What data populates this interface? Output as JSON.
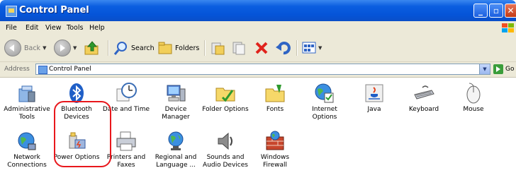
{
  "window": {
    "title": "Control Panel",
    "minimize": "_",
    "maximize": "▫",
    "close": "✕"
  },
  "menu": [
    "File",
    "Edit",
    "View",
    "Tools",
    "Help"
  ],
  "toolbar": {
    "back": "Back",
    "search": "Search",
    "folders": "Folders"
  },
  "address": {
    "label": "Address",
    "value": "Control Panel",
    "go": "Go"
  },
  "items": [
    {
      "l1": "Administrative",
      "l2": "Tools",
      "icon": "administrative-tools-icon"
    },
    {
      "l1": "Bluetooth",
      "l2": "Devices",
      "icon": "bluetooth-icon"
    },
    {
      "l1": "Date and Time",
      "l2": "",
      "icon": "date-time-icon"
    },
    {
      "l1": "Device",
      "l2": "Manager",
      "icon": "device-manager-icon"
    },
    {
      "l1": "Folder Options",
      "l2": "",
      "icon": "folder-options-icon"
    },
    {
      "l1": "Fonts",
      "l2": "",
      "icon": "fonts-icon"
    },
    {
      "l1": "Internet",
      "l2": "Options",
      "icon": "internet-options-icon"
    },
    {
      "l1": "Java",
      "l2": "",
      "icon": "java-icon"
    },
    {
      "l1": "Keyboard",
      "l2": "",
      "icon": "keyboard-icon"
    },
    {
      "l1": "Mouse",
      "l2": "",
      "icon": "mouse-icon"
    },
    {
      "l1": "Network",
      "l2": "Connections",
      "icon": "network-connections-icon"
    },
    {
      "l1": "Power Options",
      "l2": "",
      "icon": "power-options-icon"
    },
    {
      "l1": "Printers and",
      "l2": "Faxes",
      "icon": "printers-faxes-icon"
    },
    {
      "l1": "Regional and",
      "l2": "Language ...",
      "icon": "regional-language-icon"
    },
    {
      "l1": "Sounds and",
      "l2": "Audio Devices",
      "icon": "sounds-audio-icon"
    },
    {
      "l1": "Windows",
      "l2": "Firewall",
      "icon": "windows-firewall-icon"
    }
  ],
  "colors": {
    "titlebar": "#0554d8",
    "highlight": "#e8171c",
    "chrome": "#ece9d8"
  }
}
